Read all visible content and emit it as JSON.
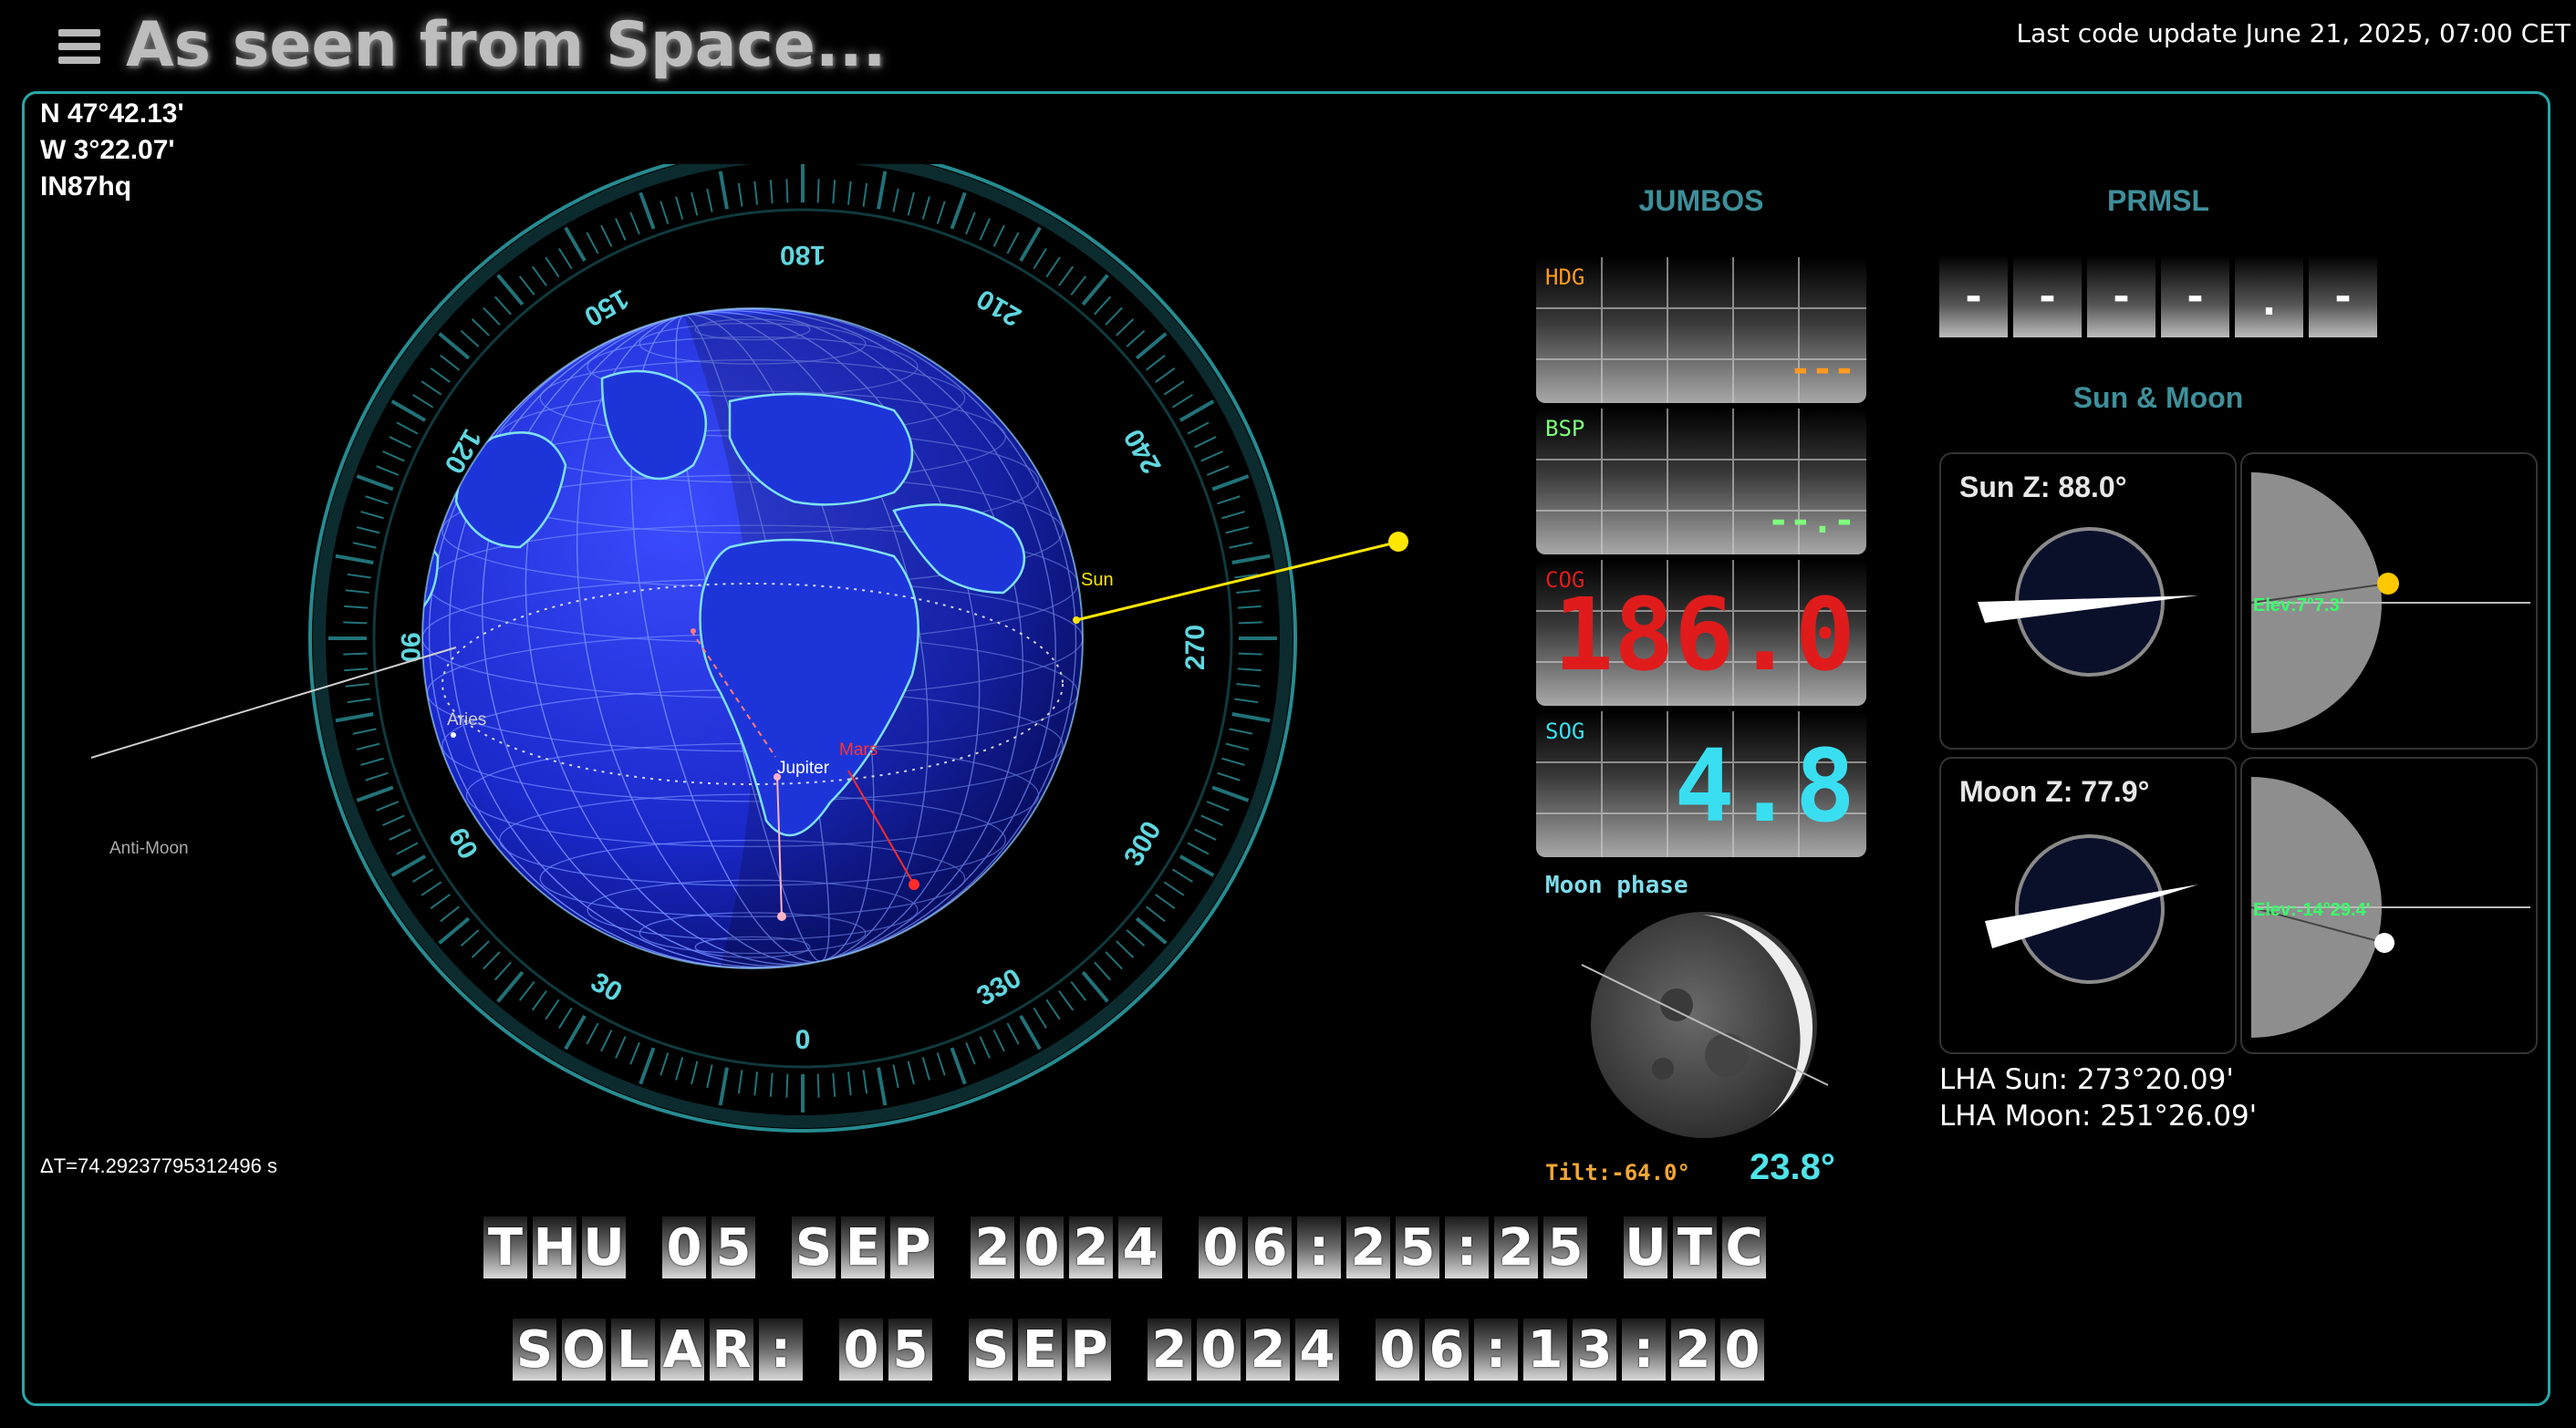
{
  "header": {
    "title": "As seen from Space...",
    "update_note": "Last code update June 21, 2025, 07:00 CET"
  },
  "position": {
    "lat": "N 47°42.13'",
    "lng": "W 3°22.07'",
    "grid": "IN87hq"
  },
  "delta_t": "ΔT=74.29237795312496 s",
  "globe": {
    "compass_labels": [
      "0",
      "30",
      "60",
      "90",
      "120",
      "150",
      "180",
      "210",
      "240",
      "270",
      "300",
      "330"
    ],
    "bodies": {
      "sun": "Sun",
      "aries": "Aries",
      "jupiter": "Jupiter",
      "mars": "Mars",
      "anti_moon": "Anti-Moon"
    },
    "colors": {
      "ocean": "#1f2fe0",
      "land": "#7fe0f0",
      "sun": "#ffe600",
      "mars": "#ff2b2b",
      "ring": "#2a9aa0"
    }
  },
  "jumbos": {
    "title": "JUMBOS",
    "displays": [
      {
        "label": "HDG",
        "value": "---",
        "color": "#ff9a1f"
      },
      {
        "label": "BSP",
        "value": "--.-",
        "color": "#7dff7d"
      },
      {
        "label": "COG",
        "value": "186.0",
        "color": "#e01b1b"
      },
      {
        "label": "SOG",
        "value": "4.8",
        "color": "#39dff0"
      }
    ]
  },
  "prmsl": {
    "title": "PRMSL",
    "digits": [
      "-",
      "-",
      "-",
      "-",
      ".",
      "-"
    ]
  },
  "sun_moon": {
    "title": "Sun & Moon",
    "sun": {
      "z_label": "Sun Z: 88.0°",
      "elev_label": "Elev:7°7.3'"
    },
    "moon": {
      "z_label": "Moon Z: 77.9°",
      "elev_label": "Elev:-14°29.4'"
    },
    "lha_sun": "LHA Sun: 273°20.09'",
    "lha_moon": "LHA Moon: 251°26.09'"
  },
  "moon_phase": {
    "label": "Moon phase",
    "tilt": "Tilt:-64.0°",
    "phase_angle": "23.8°"
  },
  "date_strips": {
    "utc": [
      "T",
      "H",
      "U",
      " ",
      "0",
      "5",
      " ",
      "S",
      "E",
      "P",
      " ",
      "2",
      "0",
      "2",
      "4",
      " ",
      "0",
      "6",
      ":",
      "2",
      "5",
      ":",
      "2",
      "5",
      " ",
      "U",
      "T",
      "C"
    ],
    "solar": [
      "S",
      "O",
      "L",
      "A",
      "R",
      ":",
      " ",
      "0",
      "5",
      " ",
      "S",
      "E",
      "P",
      " ",
      "2",
      "0",
      "2",
      "4",
      " ",
      "0",
      "6",
      ":",
      "1",
      "3",
      ":",
      "2",
      "0"
    ]
  }
}
